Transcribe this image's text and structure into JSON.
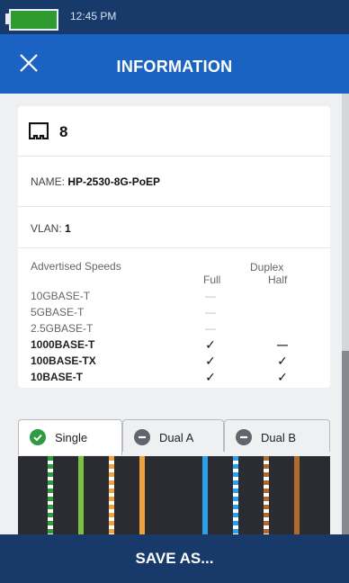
{
  "status_bar": {
    "time": "12:45 PM",
    "battery_color": "#2f9a2f"
  },
  "app_bar": {
    "title": "INFORMATION",
    "close_icon": "close-icon",
    "color": "#1a63c3"
  },
  "port": {
    "icon": "ethernet-port-icon",
    "number": "8"
  },
  "name": {
    "label": "NAME: ",
    "value": "HP-2530-8G-PoEP"
  },
  "vlan": {
    "label": "VLAN: ",
    "value": "1"
  },
  "speeds": {
    "header": "Advertised Speeds",
    "duplex_header": "Duplex",
    "full_header": "Full",
    "half_header": "Half",
    "rows": [
      {
        "name": "10GBASE-T",
        "full": "—",
        "half": "",
        "bold": false
      },
      {
        "name": "5GBASE-T",
        "full": "—",
        "half": "",
        "bold": false
      },
      {
        "name": "2.5GBASE-T",
        "full": "—",
        "half": "",
        "bold": false
      },
      {
        "name": "1000BASE-T",
        "full": "✓",
        "half": "—",
        "bold": true
      },
      {
        "name": "100BASE-TX",
        "full": "✓",
        "half": "✓",
        "bold": true
      },
      {
        "name": "10BASE-T",
        "full": "✓",
        "half": "✓",
        "bold": true
      }
    ]
  },
  "tabs": [
    {
      "label": "Single",
      "icon": "check-circle-icon",
      "active": true
    },
    {
      "label": "Dual A",
      "icon": "minus-circle-icon",
      "active": false
    },
    {
      "label": "Dual B",
      "icon": "minus-circle-icon",
      "active": false
    }
  ],
  "cable_wires": [
    {
      "color": "#2f9e3a",
      "striped": true
    },
    {
      "color": "#7cc242",
      "striped": false
    },
    {
      "color": "#f0a23c",
      "striped": true
    },
    {
      "color": "#f0a23c",
      "striped": false
    },
    {
      "color": "#2aa0ea",
      "striped": false
    },
    {
      "color": "#2aa0ea",
      "striped": true
    },
    {
      "color": "#b06a2e",
      "striped": true
    },
    {
      "color": "#b06a2e",
      "striped": false
    }
  ],
  "save_button": {
    "label": "SAVE AS..."
  }
}
